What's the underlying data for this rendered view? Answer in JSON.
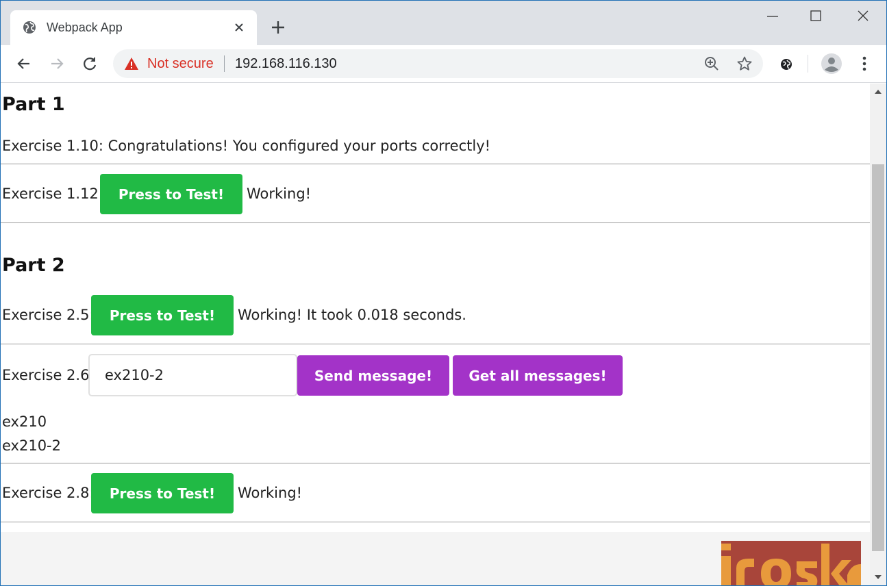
{
  "browser": {
    "tab_title": "Webpack App",
    "not_secure_label": "Not secure",
    "url": "192.168.116.130"
  },
  "page": {
    "part1": {
      "heading": "Part 1",
      "ex110": "Exercise 1.10: Congratulations! You configured your ports correctly!",
      "ex112_label": "Exercise 1.12:",
      "ex112_button": "Press to Test!",
      "ex112_result": "Working!"
    },
    "part2": {
      "heading": "Part 2",
      "ex25_label": "Exercise 2.5:",
      "ex25_button": "Press to Test!",
      "ex25_result": "Working! It took 0.018 seconds.",
      "ex26_label": "Exercise 2.6:",
      "ex26_input_value": "ex210-2",
      "ex26_send_button": "Send message!",
      "ex26_get_button": "Get all messages!",
      "messages": [
        "ex210",
        "ex210-2"
      ],
      "ex28_label": "Exercise 2.8:",
      "ex28_button": "Press to Test!",
      "ex28_result": "Working!"
    }
  },
  "colors": {
    "green_button": "#21ba45",
    "purple_button": "#a333c8",
    "not_secure": "#d93025",
    "logo_red": "#a8453a",
    "logo_orange": "#e89a3c"
  }
}
